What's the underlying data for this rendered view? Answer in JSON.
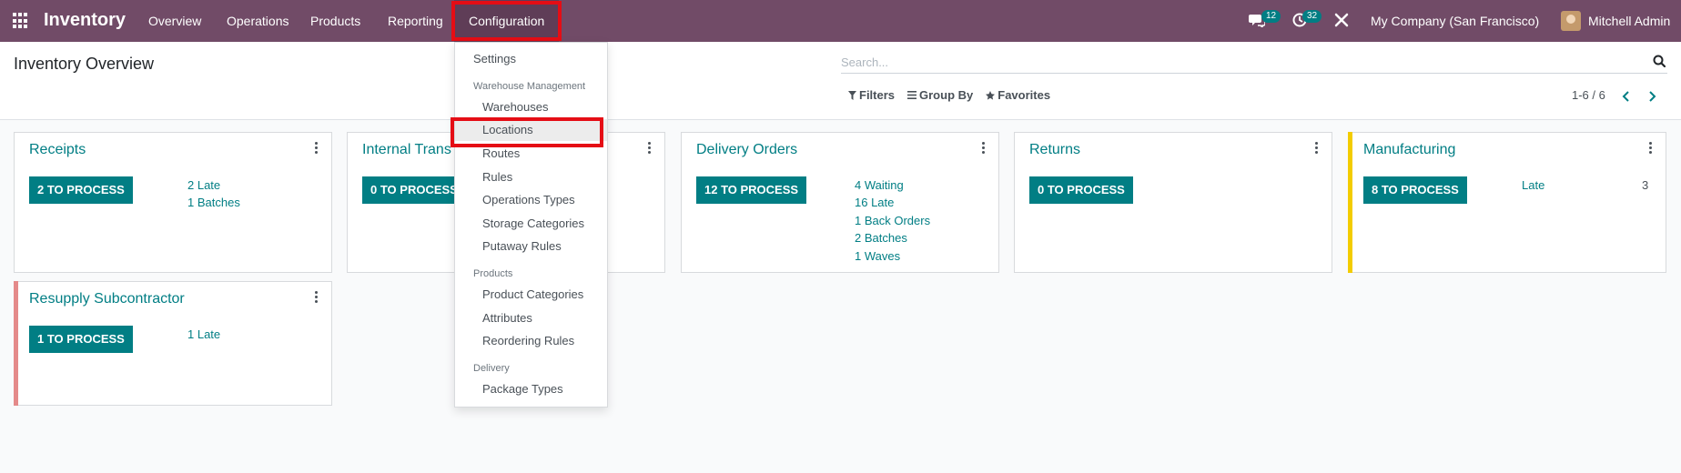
{
  "navbar": {
    "app_title": "Inventory",
    "menu": [
      "Overview",
      "Operations",
      "Products",
      "Reporting"
    ],
    "config_label": "Configuration",
    "chat_badge": "12",
    "activity_badge": "32",
    "company": "My Company (San Francisco)",
    "user": "Mitchell Admin"
  },
  "control_panel": {
    "title": "Inventory Overview",
    "search_placeholder": "Search...",
    "filters_label": "Filters",
    "groupby_label": "Group By",
    "favorites_label": "Favorites",
    "pager": "1-6 / 6"
  },
  "config_menu": {
    "settings": "Settings",
    "warehouse_header": "Warehouse Management",
    "warehouse_items": [
      "Warehouses",
      "Locations",
      "Routes",
      "Rules",
      "Operations Types",
      "Storage Categories",
      "Putaway Rules"
    ],
    "products_header": "Products",
    "products_items": [
      "Product Categories",
      "Attributes",
      "Reordering Rules"
    ],
    "delivery_header": "Delivery",
    "delivery_items": [
      "Package Types"
    ]
  },
  "cards": [
    {
      "title": "Receipts",
      "button": "2 TO PROCESS",
      "stats": [
        "2 Late",
        "1 Batches"
      ]
    },
    {
      "title": "Internal Trans",
      "button": "0 TO PROCESS",
      "stats": []
    },
    {
      "title": "Delivery Orders",
      "button": "12 TO PROCESS",
      "stats": [
        "4 Waiting",
        "16 Late",
        "1 Back Orders",
        "2 Batches",
        "1 Waves"
      ]
    },
    {
      "title": "Returns",
      "button": "0 TO PROCESS",
      "stats": []
    },
    {
      "title": "Manufacturing",
      "button": "8 TO PROCESS",
      "stats": [
        "Late"
      ],
      "count": "3"
    },
    {
      "title": "Resupply Subcontractor",
      "button": "1 TO PROCESS",
      "stats": [
        "1 Late"
      ]
    }
  ],
  "colors": {
    "navbar": "#714b67",
    "primary": "#017e84",
    "highlight": "#e50d15",
    "manufacturing_accent": "#f3cc00",
    "subcontractor_accent": "#e48a8a"
  }
}
